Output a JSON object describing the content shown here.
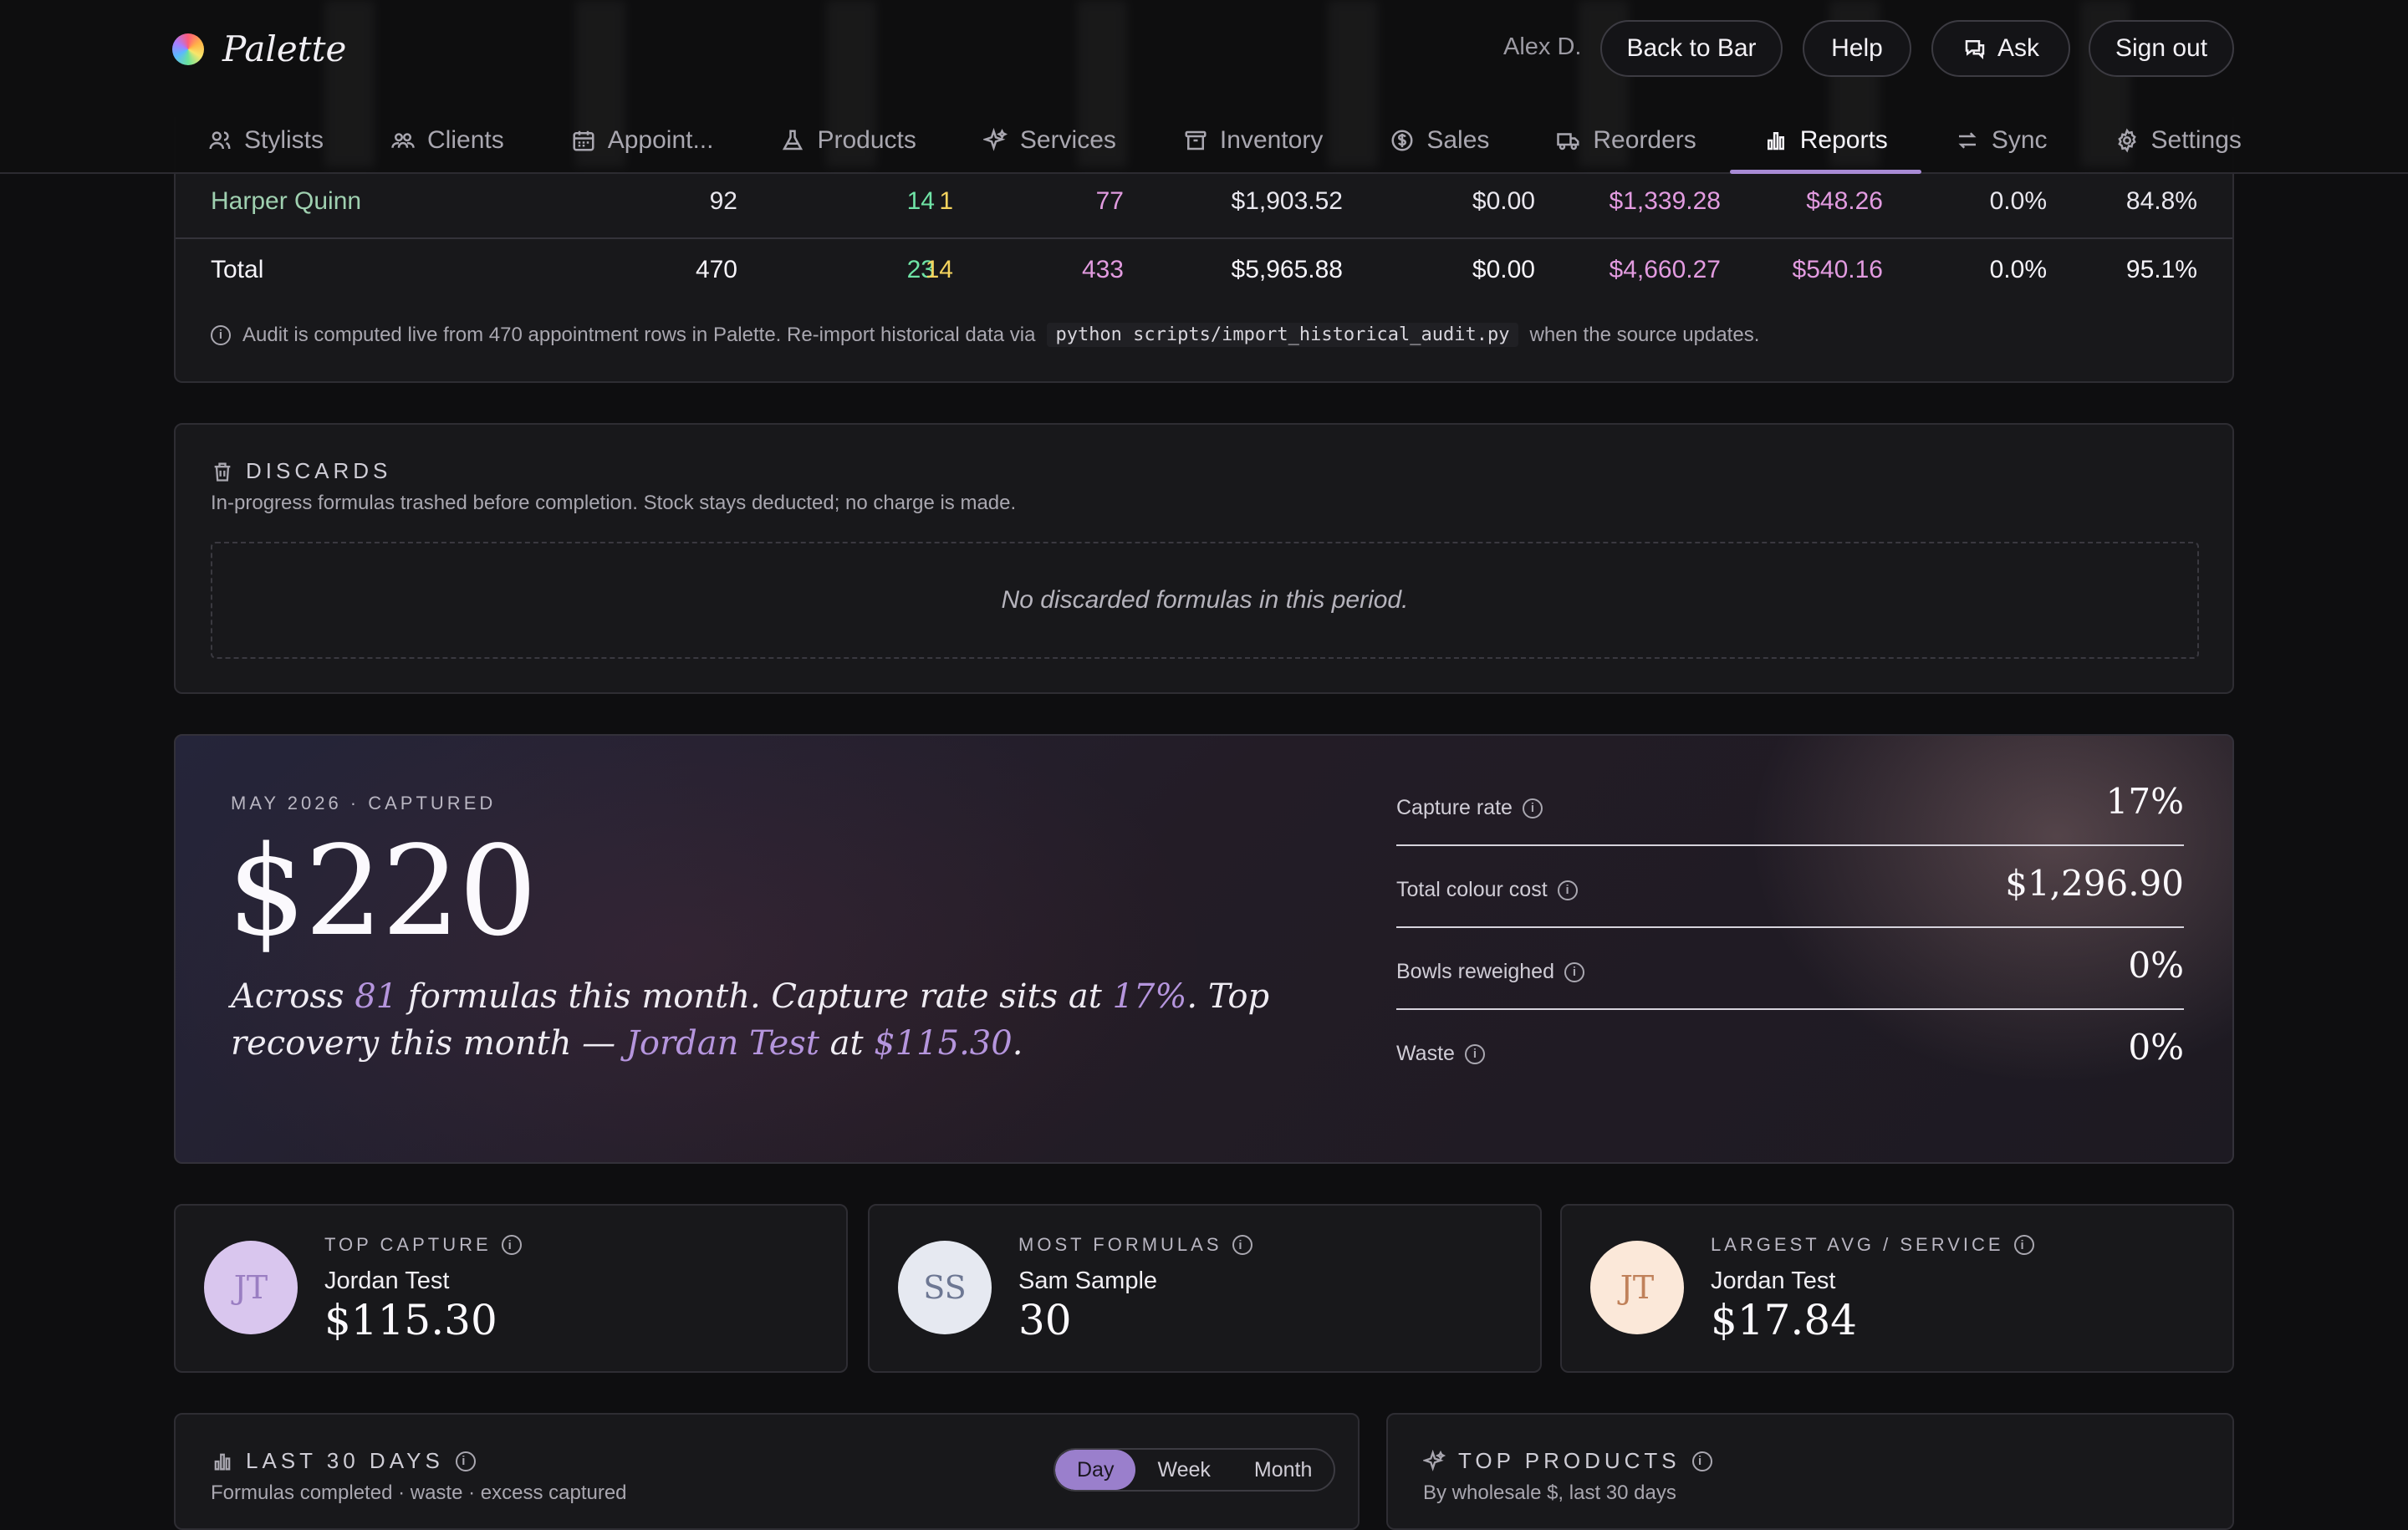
{
  "brand": {
    "name": "Palette"
  },
  "header": {
    "user": "Alex D.",
    "back_label": "Back to Bar",
    "help_label": "Help",
    "ask_label": "Ask",
    "signout_label": "Sign out"
  },
  "nav": {
    "tabs": [
      {
        "label": "Stylists",
        "icon": "users-icon"
      },
      {
        "label": "Clients",
        "icon": "clients-icon"
      },
      {
        "label": "Appoint...",
        "icon": "calendar-icon"
      },
      {
        "label": "Products",
        "icon": "flask-icon"
      },
      {
        "label": "Services",
        "icon": "sparkles-icon"
      },
      {
        "label": "Inventory",
        "icon": "archive-icon"
      },
      {
        "label": "Sales",
        "icon": "dollar-icon"
      },
      {
        "label": "Reorders",
        "icon": "truck-icon"
      },
      {
        "label": "Reports",
        "icon": "bar-chart-icon",
        "active": true
      },
      {
        "label": "Sync",
        "icon": "sync-icon"
      },
      {
        "label": "Settings",
        "icon": "gear-icon"
      }
    ]
  },
  "audit": {
    "rows": [
      {
        "name": "Harper Quinn",
        "c1": "92",
        "c2": "14",
        "c3": "1",
        "c4": "77",
        "c5": "$1,903.52",
        "c6": "$0.00",
        "c7": "$1,339.28",
        "c8": "$48.26",
        "c9": "0.0%",
        "c10": "84.8%"
      }
    ],
    "total": {
      "name": "Total",
      "c1": "470",
      "c2": "23",
      "c3": "14",
      "c4": "433",
      "c5": "$5,965.88",
      "c6": "$0.00",
      "c7": "$4,660.27",
      "c8": "$540.16",
      "c9": "0.0%",
      "c10": "95.1%"
    },
    "note_pre": "Audit is computed live from 470 appointment rows in Palette. Re-import historical data via",
    "note_code": "python scripts/import_historical_audit.py",
    "note_post": "when the source updates."
  },
  "discards": {
    "title": "DISCARDS",
    "subtitle": "In-progress formulas trashed before completion. Stock stays deducted; no charge is made.",
    "empty": "No discarded formulas in this period."
  },
  "hero": {
    "eyebrow": "MAY 2026 · CAPTURED",
    "amount": "$220",
    "s1": "Across ",
    "formulas": "81",
    "s2": " formulas this month. Capture rate sits at ",
    "rate": "17%",
    "s3": ". Top recovery this month — ",
    "top_name": "Jordan Test",
    "s4": " at ",
    "top_amount": "$115.30",
    "s5": ".",
    "metrics": [
      {
        "label": "Capture rate",
        "value": "17%"
      },
      {
        "label": "Total colour cost",
        "value": "$1,296.90"
      },
      {
        "label": "Bowls reweighed",
        "value": "0%"
      },
      {
        "label": "Waste",
        "value": "0%"
      }
    ]
  },
  "stats": [
    {
      "initials": "JT",
      "label": "TOP CAPTURE",
      "name": "Jordan Test",
      "value": "$115.30",
      "bg": "#d9c6ee",
      "fg": "#9a7ec2"
    },
    {
      "initials": "SS",
      "label": "MOST FORMULAS",
      "name": "Sam Sample",
      "value": "30",
      "bg": "#e6e9f1",
      "fg": "#6d7793"
    },
    {
      "initials": "JT",
      "label": "LARGEST AVG / SERVICE",
      "name": "Jordan Test",
      "value": "$17.84",
      "bg": "#fbe8d9",
      "fg": "#c0815a"
    }
  ],
  "last30": {
    "title": "LAST 30 DAYS",
    "subtitle": "Formulas completed · waste · excess captured",
    "seg": [
      "Day",
      "Week",
      "Month"
    ],
    "active": "Day"
  },
  "top_products": {
    "title": "TOP PRODUCTS",
    "subtitle": "By wholesale $, last 30 days"
  },
  "colors": {
    "accent": "#a88bd6",
    "green": "#6fe3a6",
    "yellow": "#f4d35e",
    "pink": "#e29be0",
    "name_green": "#9fd0b0"
  }
}
